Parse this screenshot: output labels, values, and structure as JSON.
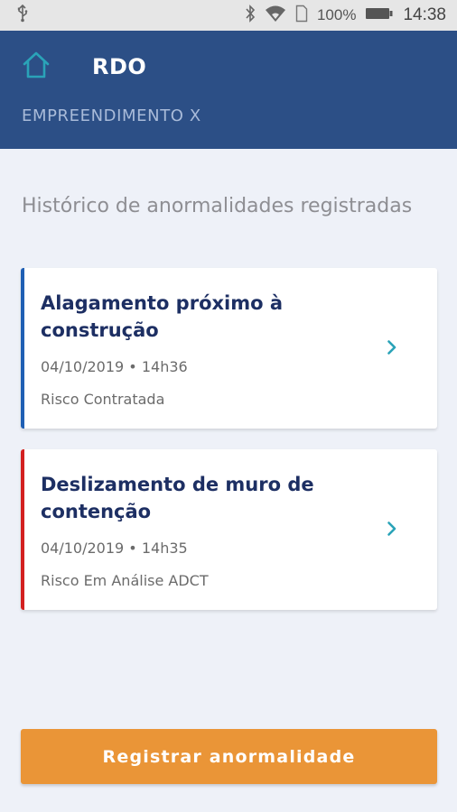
{
  "status_bar": {
    "battery_percent": "100%",
    "time": "14:38",
    "icons": [
      "usb-icon",
      "bluetooth-icon",
      "wifi-icon",
      "sim-icon",
      "battery-icon"
    ]
  },
  "header": {
    "title": "RDO",
    "subtitle": "EMPREENDIMENTO X",
    "home_icon": "home-icon"
  },
  "section": {
    "title": "Histórico de anormalidades registradas"
  },
  "anomalies": [
    {
      "title": "Alagamento próximo à construção",
      "datetime": "04/10/2019 • 14h36",
      "status": "Risco Contratada",
      "accent_color": "#1f5fb4"
    },
    {
      "title": "Deslizamento de muro de contenção",
      "datetime": "04/10/2019 • 14h35",
      "status": "Risco Em Análise ADCT",
      "accent_color": "#d32020"
    }
  ],
  "actions": {
    "register_label": "Registrar anormalidade"
  },
  "colors": {
    "header_bg": "#2c4f86",
    "page_bg": "#eef1f8",
    "button_bg": "#ea9537",
    "chevron": "#2aa3b8",
    "home_icon": "#2aa3b8"
  }
}
